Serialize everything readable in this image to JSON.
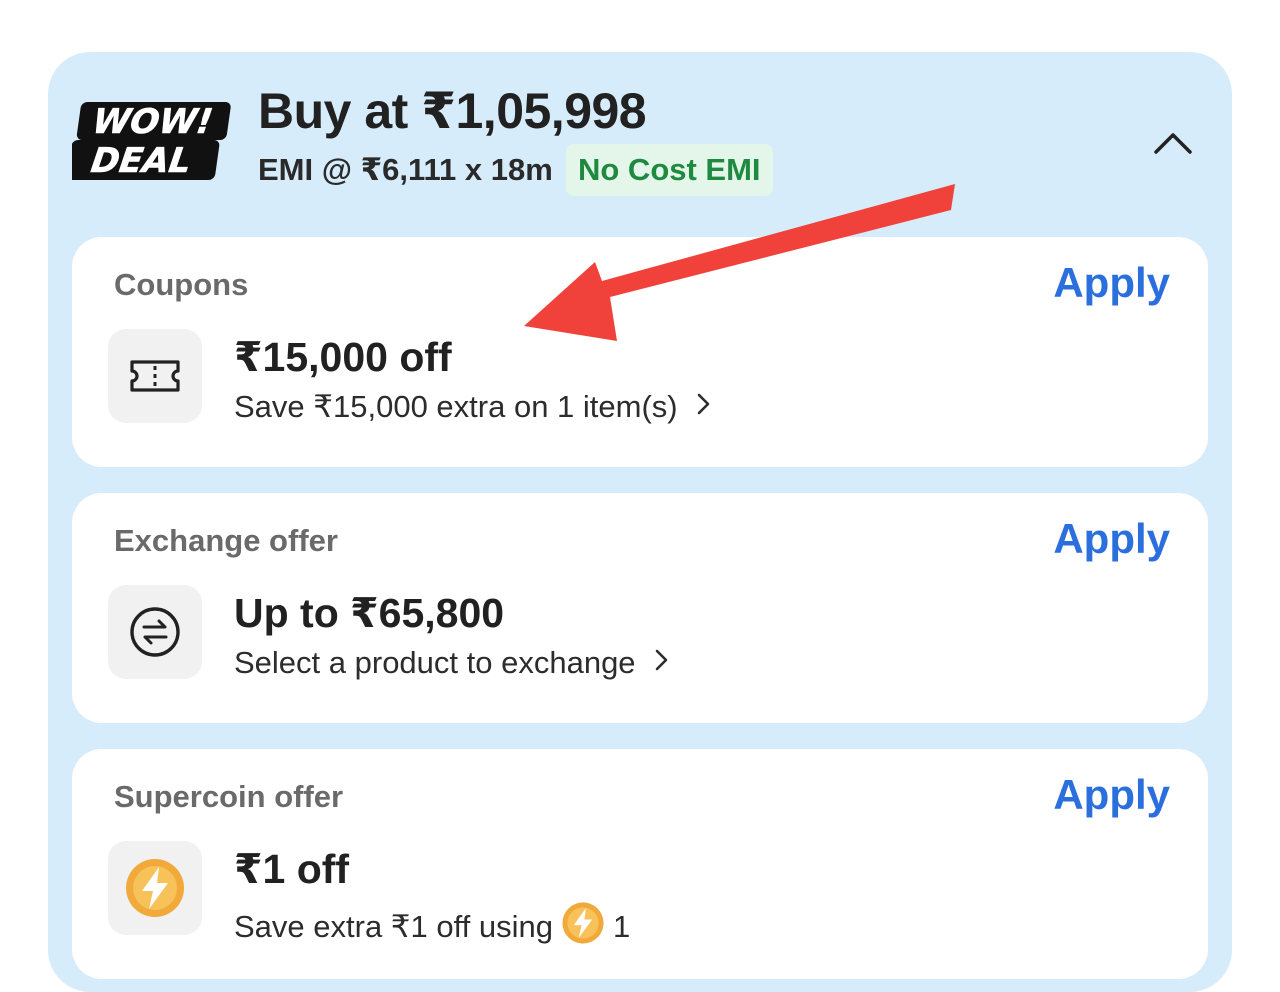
{
  "deal": {
    "badge_line1": "WOW!",
    "badge_line2": "DEAL",
    "price_text": "Buy at ₹1,05,998",
    "emi_text": "EMI @ ₹6,111 x 18m",
    "emi_badge": "No Cost EMI",
    "collapse_icon": "chevron-up-icon"
  },
  "offers": [
    {
      "section": "Coupons",
      "apply_label": "Apply",
      "icon": "ticket-icon",
      "headline": "₹15,000 off",
      "subtext": "Save ₹15,000 extra on 1 item(s)"
    },
    {
      "section": "Exchange offer",
      "apply_label": "Apply",
      "icon": "exchange-icon",
      "headline": "Up to ₹65,800",
      "subtext": "Select a product to exchange"
    },
    {
      "section": "Supercoin offer",
      "apply_label": "Apply",
      "icon": "supercoin-icon",
      "headline": "₹1 off",
      "subtext_before": "Save extra ₹1 off using",
      "subtext_after": "1"
    }
  ],
  "colors": {
    "panel_bg": "#d7ecfb",
    "apply": "#2a6fdc",
    "no_cost_text": "#1f8a3f",
    "no_cost_bg": "#e4f6ea",
    "annotation_arrow": "#f0423a"
  }
}
